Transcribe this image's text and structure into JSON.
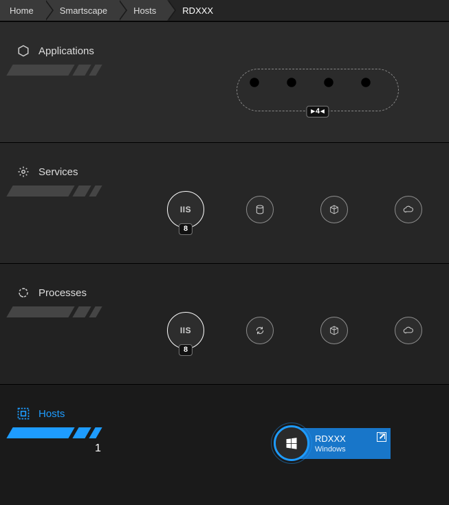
{
  "breadcrumbs": [
    "Home",
    "Smartscape",
    "Hosts",
    "RDXXX"
  ],
  "layers": {
    "applications": {
      "label": "Applications",
      "cluster_count": "4"
    },
    "services": {
      "label": "Services",
      "iis_count": "8"
    },
    "processes": {
      "label": "Processes",
      "iis_count": "8"
    },
    "hosts": {
      "label": "Hosts",
      "count": "1"
    }
  },
  "host": {
    "name": "RDXXX",
    "os": "Windows"
  },
  "colors": {
    "accent": "#1e9cff"
  }
}
